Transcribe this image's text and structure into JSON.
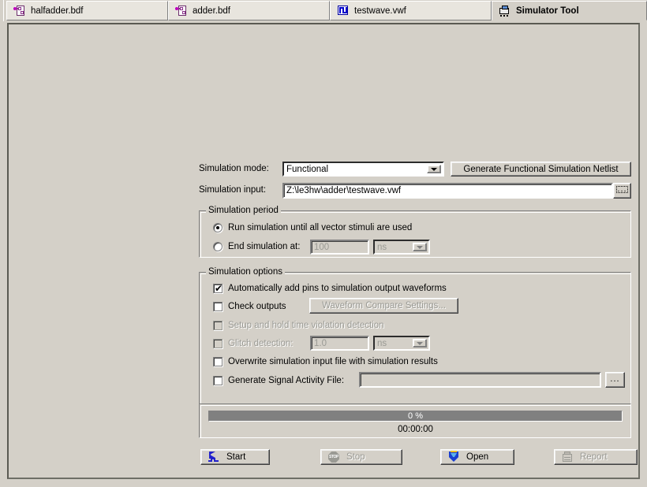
{
  "tabs": [
    {
      "label": "halfadder.bdf",
      "icon": "bdf-document-icon",
      "active": false
    },
    {
      "label": "adder.bdf",
      "icon": "bdf-document-icon",
      "active": false
    },
    {
      "label": "testwave.vwf",
      "icon": "vwf-waveform-icon",
      "active": false
    },
    {
      "label": "Simulator Tool",
      "icon": "simulator-tool-icon",
      "active": true
    }
  ],
  "form": {
    "simulation_mode_label": "Simulation mode:",
    "simulation_mode_value": "Functional",
    "generate_netlist_button": "Generate Functional Simulation Netlist",
    "simulation_input_label": "Simulation input:",
    "simulation_input_value": "Z:\\le3hw\\adder\\testwave.vwf",
    "browse_button": "..."
  },
  "simulation_period": {
    "title": "Simulation period",
    "run_until_all_label": "Run simulation until all vector stimuli are used",
    "run_until_all_selected": true,
    "end_simulation_label": "End simulation at:",
    "end_simulation_selected": false,
    "end_time_value": "100",
    "end_time_unit": "ns"
  },
  "simulation_options": {
    "title": "Simulation options",
    "auto_add_pins_label": "Automatically add pins to simulation output waveforms",
    "auto_add_pins_checked": true,
    "check_outputs_label": "Check outputs",
    "check_outputs_checked": false,
    "waveform_compare_button": "Waveform Compare Settings...",
    "setup_hold_label": "Setup and hold time violation detection",
    "setup_hold_checked": false,
    "glitch_detection_label": "Glitch detection:",
    "glitch_detection_checked": false,
    "glitch_value": "1.0",
    "glitch_unit": "ns",
    "overwrite_label": "Overwrite simulation input file with simulation results",
    "overwrite_checked": false,
    "signal_activity_label": "Generate Signal Activity File:",
    "signal_activity_checked": false,
    "signal_activity_value": "",
    "signal_activity_browse": "..."
  },
  "progress": {
    "percent_text": "0 %",
    "percent_value": 0,
    "elapsed_time": "00:00:00"
  },
  "actions": [
    {
      "label": "Start",
      "icon": "start-flag-icon",
      "enabled": true
    },
    {
      "label": "Stop",
      "icon": "stop-sign-icon",
      "enabled": false
    },
    {
      "label": "Open",
      "icon": "open-shield-icon",
      "enabled": true
    },
    {
      "label": "Report",
      "icon": "report-document-icon",
      "enabled": false
    }
  ],
  "colors": {
    "window_bg": "#d4d0c8",
    "tab_inactive": "#e8e5de",
    "progress_fill": "#808080",
    "disabled_text": "#9a9a94",
    "accent_blue": "#2222cc"
  }
}
